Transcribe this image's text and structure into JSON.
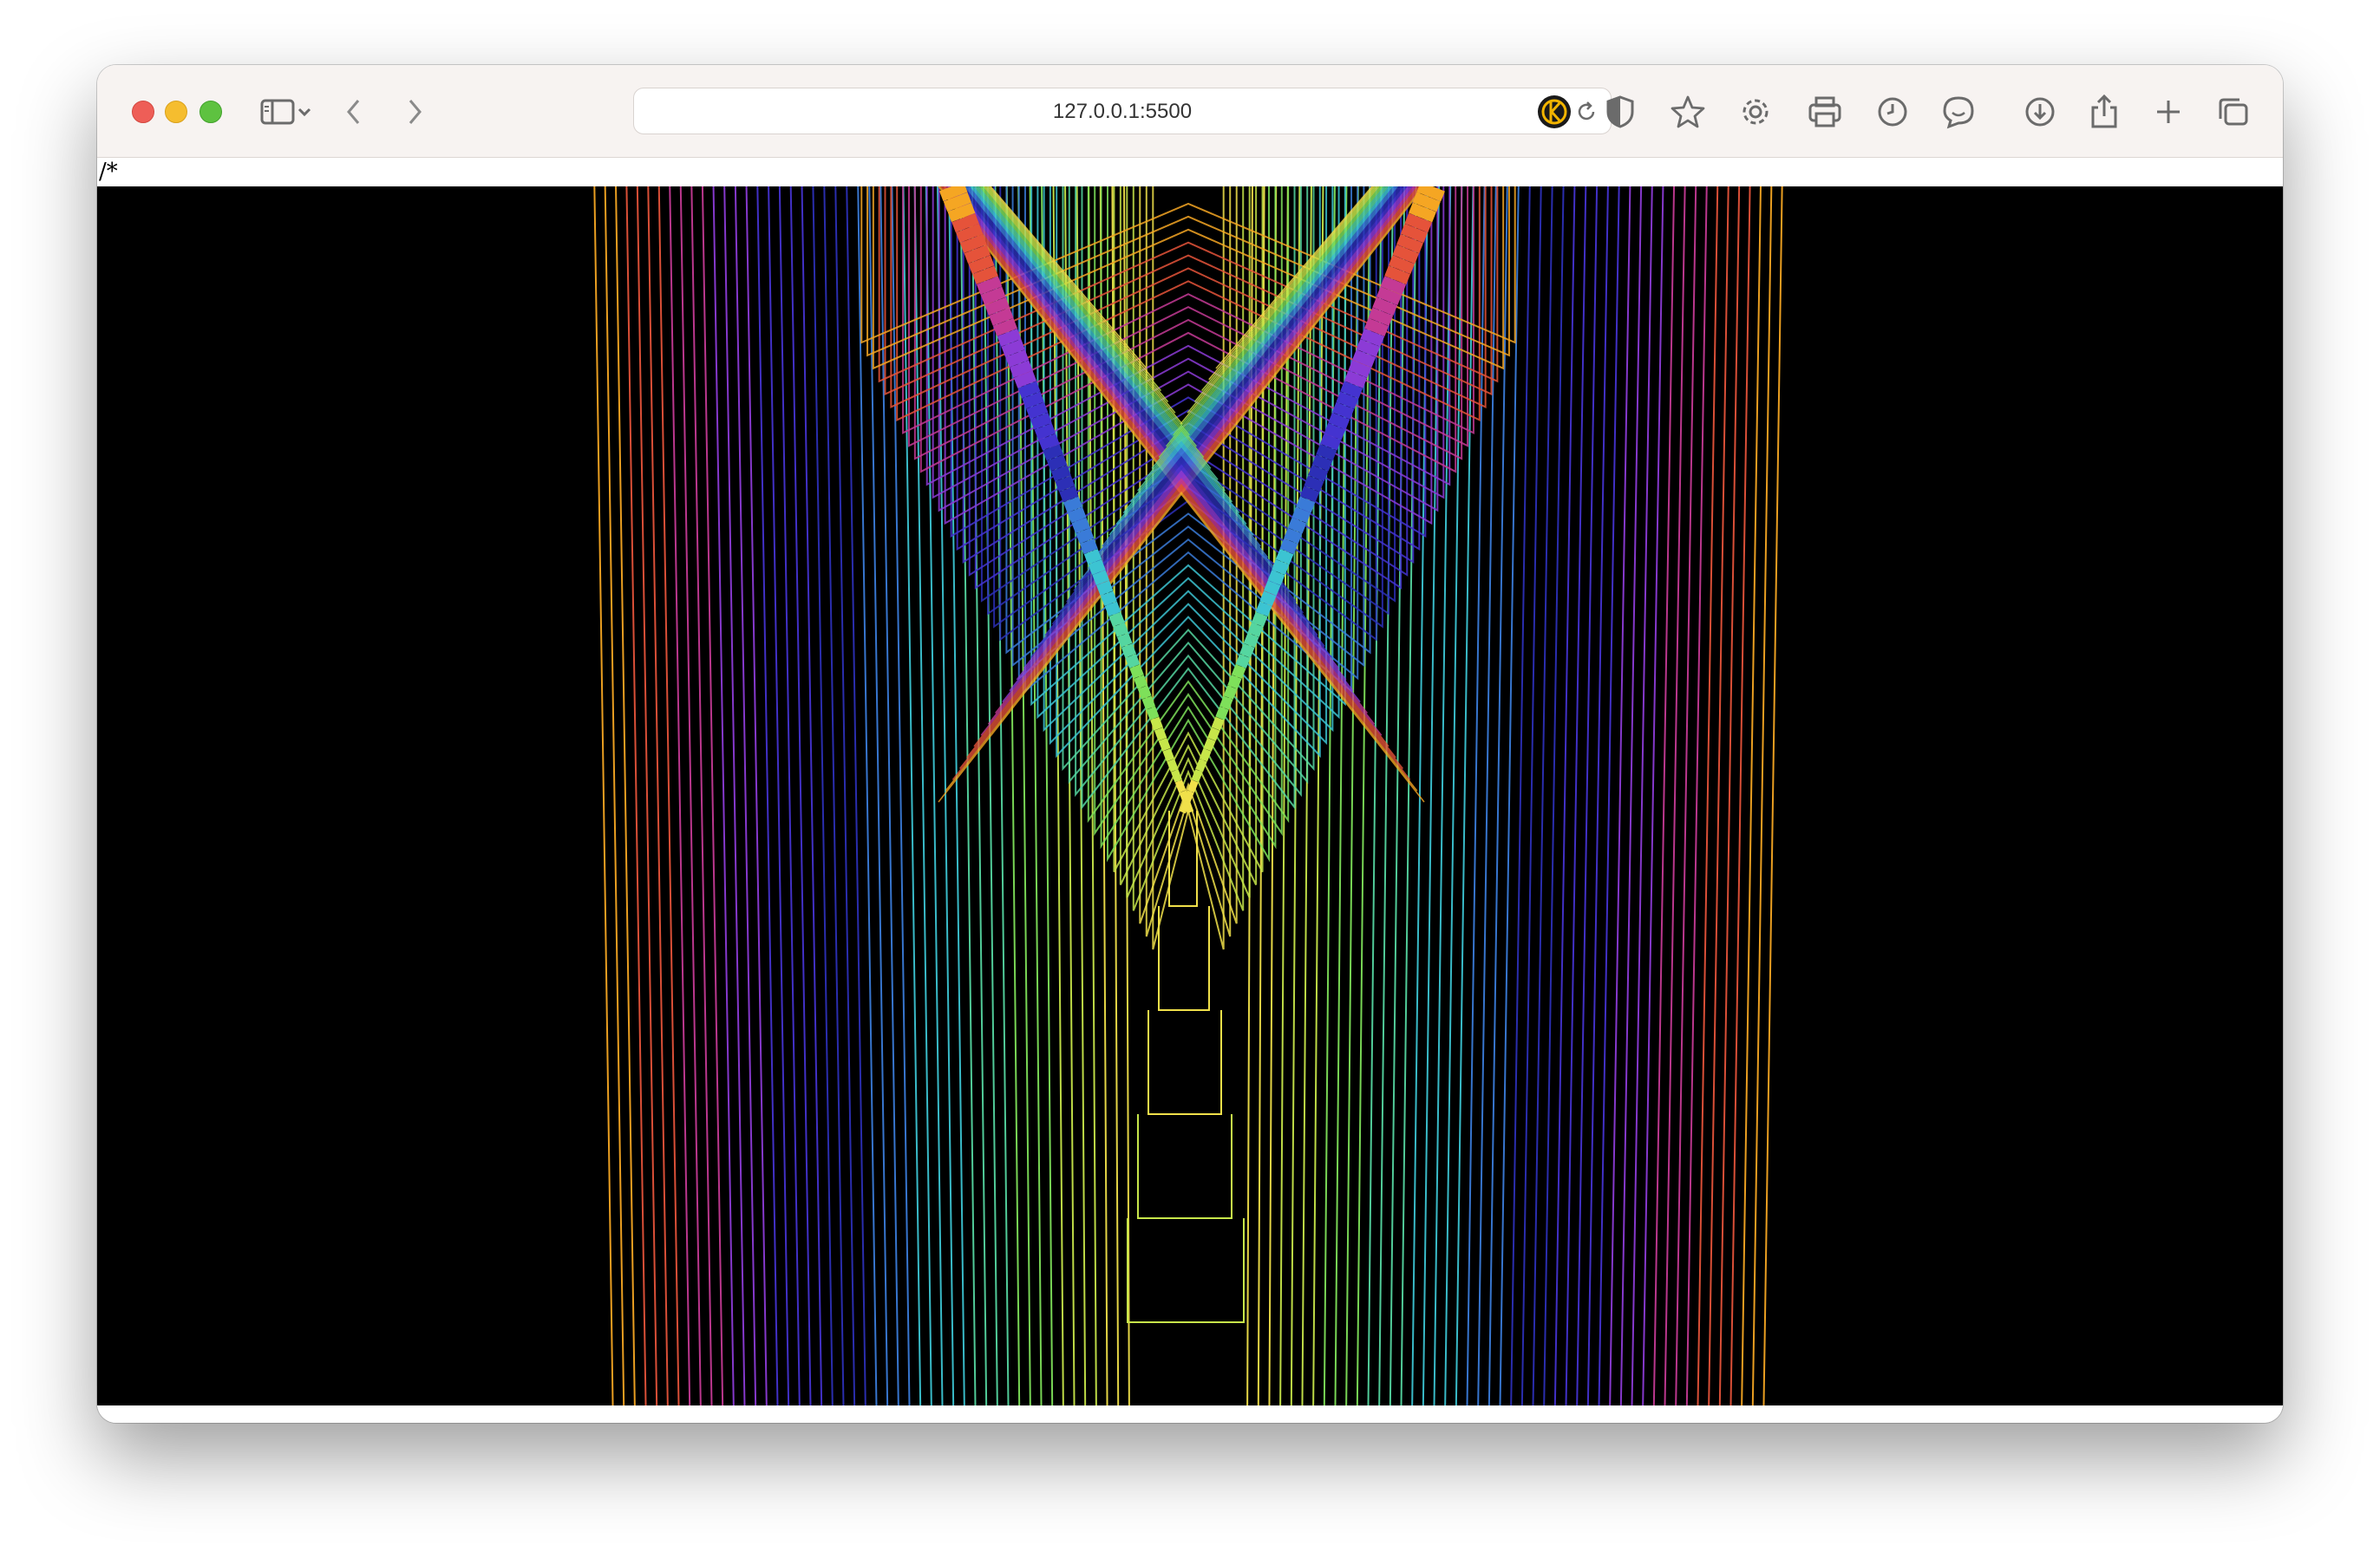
{
  "browser": {
    "url": "127.0.0.1:5500",
    "icons": {
      "sidebar": "sidebar-icon",
      "sidebar_menu": "chevron-down-icon",
      "back": "chevron-left-icon",
      "forward": "chevron-right-icon",
      "reload": "reload-icon",
      "extension_1": "extension-icon",
      "privacy": "shield-icon",
      "bookmark": "star-icon",
      "settings": "gear-icon",
      "print": "printer-icon",
      "history": "clock-icon",
      "chat": "chat-bubble-icon",
      "downloads": "download-icon",
      "share": "share-icon",
      "new_tab": "plus-icon",
      "tabs_overview": "tabs-icon"
    }
  },
  "page": {
    "stray_text": "/*",
    "background": "#000000",
    "palette": [
      "#f5a623",
      "#e5533a",
      "#c43a95",
      "#8c3bd6",
      "#4433d0",
      "#2c2fb6",
      "#3a7bd8",
      "#3cc4d2",
      "#55d6a0",
      "#7ee05a",
      "#c7e64a",
      "#f0e04a"
    ]
  }
}
